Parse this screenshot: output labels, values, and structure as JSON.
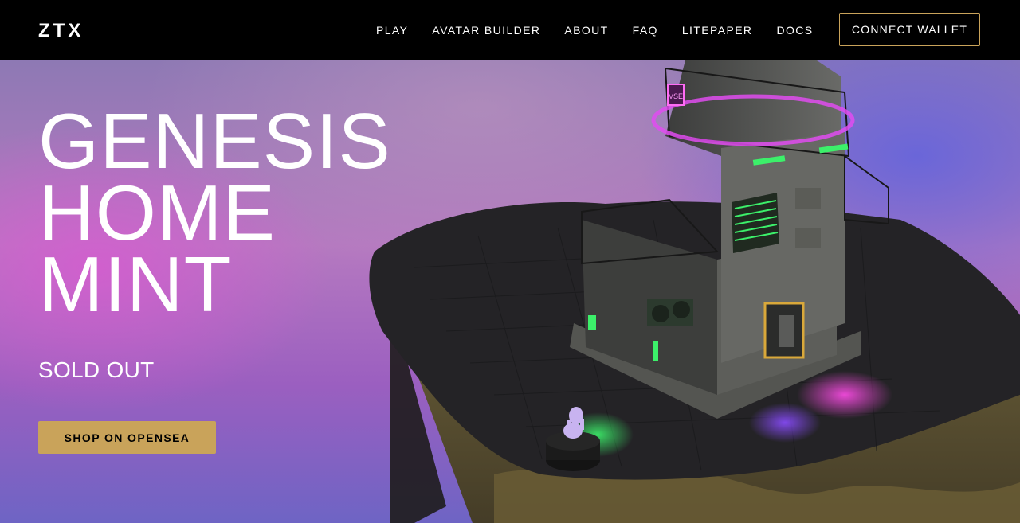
{
  "header": {
    "logo_text": "ZTX",
    "nav": [
      "PLAY",
      "AVATAR BUILDER",
      "ABOUT",
      "FAQ",
      "LITEPAPER",
      "DOCS"
    ],
    "connect_label": "CONNECT WALLET"
  },
  "hero": {
    "title_lines": [
      "GENESIS",
      "HOME",
      "MINT"
    ],
    "status": "SOLD OUT",
    "cta_label": "SHOP ON OPENSEA",
    "sign_text": "VSE"
  },
  "colors": {
    "accent_gold": "#c9a35a",
    "neon_pink": "#e04cf0",
    "neon_green": "#3cf06a"
  }
}
